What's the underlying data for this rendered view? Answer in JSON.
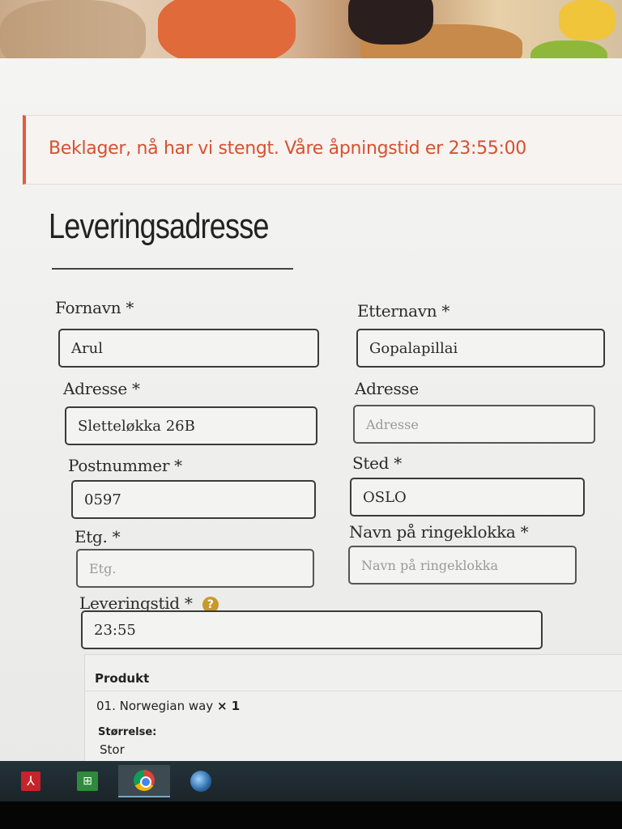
{
  "notice": {
    "text": "Beklager, nå har vi stengt. Våre åpningstid er 23:55:00",
    "color": "#e25c3b"
  },
  "section": {
    "title": "Leveringsadresse"
  },
  "form": {
    "first_name": {
      "label": "Fornavn *",
      "value": "Arul"
    },
    "last_name": {
      "label": "Etternavn *",
      "value": "Gopalapillai"
    },
    "address1": {
      "label": "Adresse *",
      "value": "Slettеløkka 26B"
    },
    "address2": {
      "label": "Adresse",
      "placeholder": "Adresse"
    },
    "postcode": {
      "label": "Postnummer *",
      "value": "0597"
    },
    "city": {
      "label": "Sted *",
      "value": "OSLO"
    },
    "floor": {
      "label": "Etg. *",
      "placeholder": "Etg."
    },
    "doorbell": {
      "label": "Navn på ringeklokka *",
      "placeholder": "Navn på ringeklokka"
    },
    "delivery_time": {
      "label": "Leveringstid *",
      "value": "23:55",
      "help_icon": "?"
    }
  },
  "summary": {
    "column_header": "Produkt",
    "item_name": "01. Norwegian way",
    "item_qty": "× 1",
    "meta_label": "Størrelse:",
    "meta_value": "Stor"
  },
  "taskbar": {
    "icons": [
      "pdf-icon",
      "store-icon",
      "chrome-icon",
      "globe-icon"
    ]
  }
}
